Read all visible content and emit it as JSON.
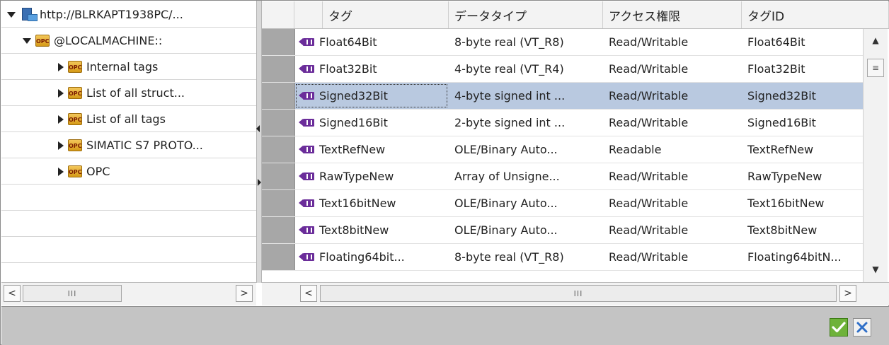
{
  "tree": {
    "nodes": [
      {
        "label": "http://BLRKAPT1938PC/...",
        "icon": "server-icon",
        "expanded": true
      },
      {
        "label": "@LOCALMACHINE::",
        "icon": "opc-folder-icon",
        "expanded": true
      },
      {
        "label": "Internal tags",
        "icon": "opc-folder-icon",
        "expanded": false
      },
      {
        "label": "List of all struct...",
        "icon": "opc-folder-icon",
        "expanded": false
      },
      {
        "label": "List of all tags",
        "icon": "opc-folder-icon",
        "expanded": false
      },
      {
        "label": "SIMATIC S7 PROTO...",
        "icon": "opc-folder-icon",
        "expanded": false
      },
      {
        "label": "OPC",
        "icon": "opc-folder-icon",
        "expanded": false
      }
    ],
    "opc_icon_text": "OPC"
  },
  "table": {
    "columns": [
      "タグ",
      "データタイプ",
      "アクセス権限",
      "タグID"
    ],
    "rows": [
      {
        "tag": "Float64Bit",
        "type": "8-byte real (VT_R8)",
        "access": "Read/Writable",
        "id": "Float64Bit"
      },
      {
        "tag": "Float32Bit",
        "type": "4-byte real (VT_R4)",
        "access": "Read/Writable",
        "id": "Float32Bit"
      },
      {
        "tag": "Signed32Bit",
        "type": "4-byte signed int ...",
        "access": "Read/Writable",
        "id": "Signed32Bit"
      },
      {
        "tag": "Signed16Bit",
        "type": "2-byte signed int ...",
        "access": "Read/Writable",
        "id": "Signed16Bit"
      },
      {
        "tag": "TextRefNew",
        "type": "OLE/Binary Auto...",
        "access": "Readable",
        "id": "TextRefNew"
      },
      {
        "tag": "RawTypeNew",
        "type": "Array of Unsigne...",
        "access": "Read/Writable",
        "id": "RawTypeNew"
      },
      {
        "tag": "Text16bitNew",
        "type": "OLE/Binary Auto...",
        "access": "Read/Writable",
        "id": "Text16bitNew"
      },
      {
        "tag": "Text8bitNew",
        "type": "OLE/Binary Auto...",
        "access": "Read/Writable",
        "id": "Text8bitNew"
      },
      {
        "tag": "Floating64bit...",
        "type": "8-byte real (VT_R8)",
        "access": "Read/Writable",
        "id": "Floating64bitN..."
      }
    ],
    "selected_row": "Signed32Bit"
  },
  "scroll": {
    "left_arrow": "<",
    "right_arrow": ">",
    "up_arrow": "▲",
    "down_arrow": "▼",
    "thumb_grip": "III",
    "vthumb_grip": "≡"
  },
  "footer": {
    "ok_icon": "checkmark-icon",
    "cancel_icon": "x-icon"
  },
  "colors": {
    "selection": "#b9c9e0",
    "tag_icon": "#6b2d9a",
    "ok_green": "#6eb23a",
    "cancel_blue": "#2f6fc8"
  }
}
